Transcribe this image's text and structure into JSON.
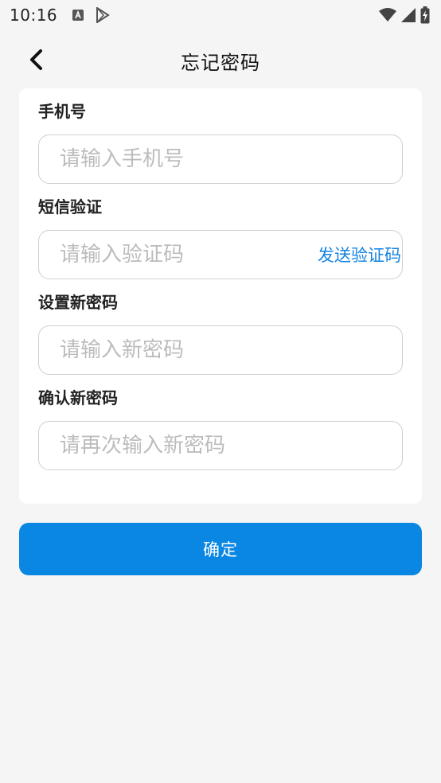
{
  "status_bar": {
    "time": "10:16",
    "icons": [
      "font-a-icon",
      "play-store-icon",
      "wifi-icon",
      "signal-icon",
      "battery-icon"
    ]
  },
  "header": {
    "title": "忘记密码",
    "back_icon": "chevron-left-icon"
  },
  "form": {
    "phone": {
      "label": "手机号",
      "value": "",
      "placeholder": "请输入手机号"
    },
    "sms": {
      "label": "短信验证",
      "value": "",
      "placeholder": "请输入验证码",
      "send_code_label": "发送验证码"
    },
    "new_password": {
      "label": "设置新密码",
      "value": "",
      "placeholder": "请输入新密码"
    },
    "confirm_password": {
      "label": "确认新密码",
      "value": "",
      "placeholder": "请再次输入新密码"
    }
  },
  "actions": {
    "confirm_label": "确定"
  },
  "colors": {
    "accent": "#0a86e3",
    "link": "#1283e2",
    "background": "#f5f5f5",
    "card": "#ffffff"
  }
}
